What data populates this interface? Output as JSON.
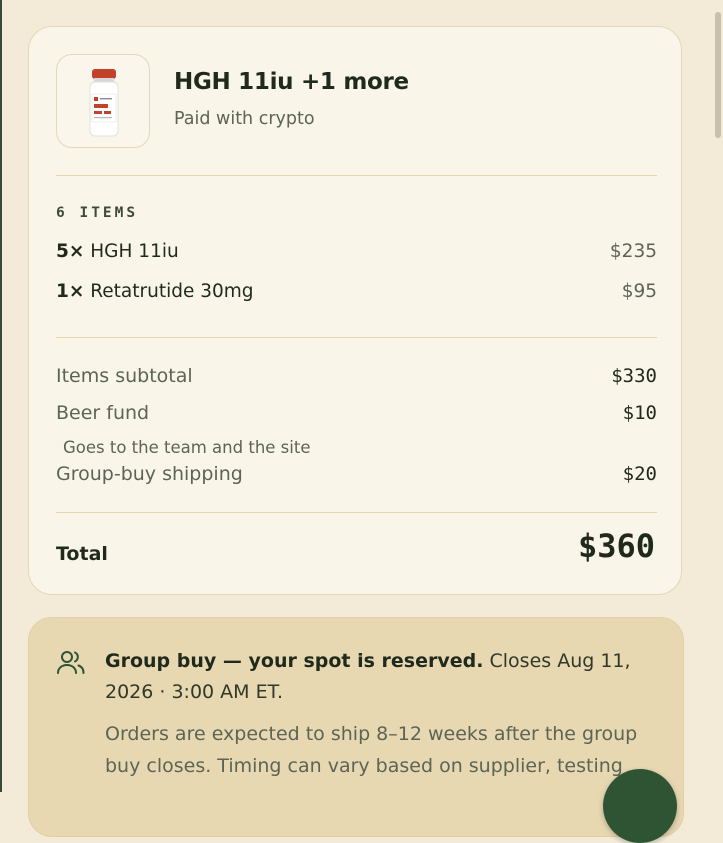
{
  "product": {
    "title": "HGH 11iu +1 more",
    "subtitle": "Paid with crypto",
    "image_icon": "peptide-vial"
  },
  "items": {
    "heading": "6 ITEMS",
    "list": [
      {
        "qty": "5×",
        "name": "HGH 11iu",
        "price": "$235"
      },
      {
        "qty": "1×",
        "name": "Retatrutide 30mg",
        "price": "$95"
      }
    ]
  },
  "summary": {
    "subtotal_label": "Items subtotal",
    "subtotal_value": "$330",
    "beer_label": "Beer fund",
    "beer_value": "$10",
    "beer_note": "Goes to the team and the site",
    "shipping_label": "Group-buy shipping",
    "shipping_value": "$20",
    "total_label": "Total",
    "total_value": "$360"
  },
  "group_buy": {
    "icon": "users-icon",
    "headline_strong": "Group buy — your spot is reserved.",
    "headline_rest": " Closes Aug 11, 2026 · 3:00 AM ET.",
    "body": "Orders are expected to ship 8–12 weeks after the group buy closes. Timing can vary based on supplier, testing"
  },
  "colors": {
    "page_bg": "#f3ead8",
    "card_bg": "#faf5e9",
    "notice_bg": "#e8d8b2",
    "accent_green": "#2f5434",
    "vial_cap": "#c2412b"
  }
}
